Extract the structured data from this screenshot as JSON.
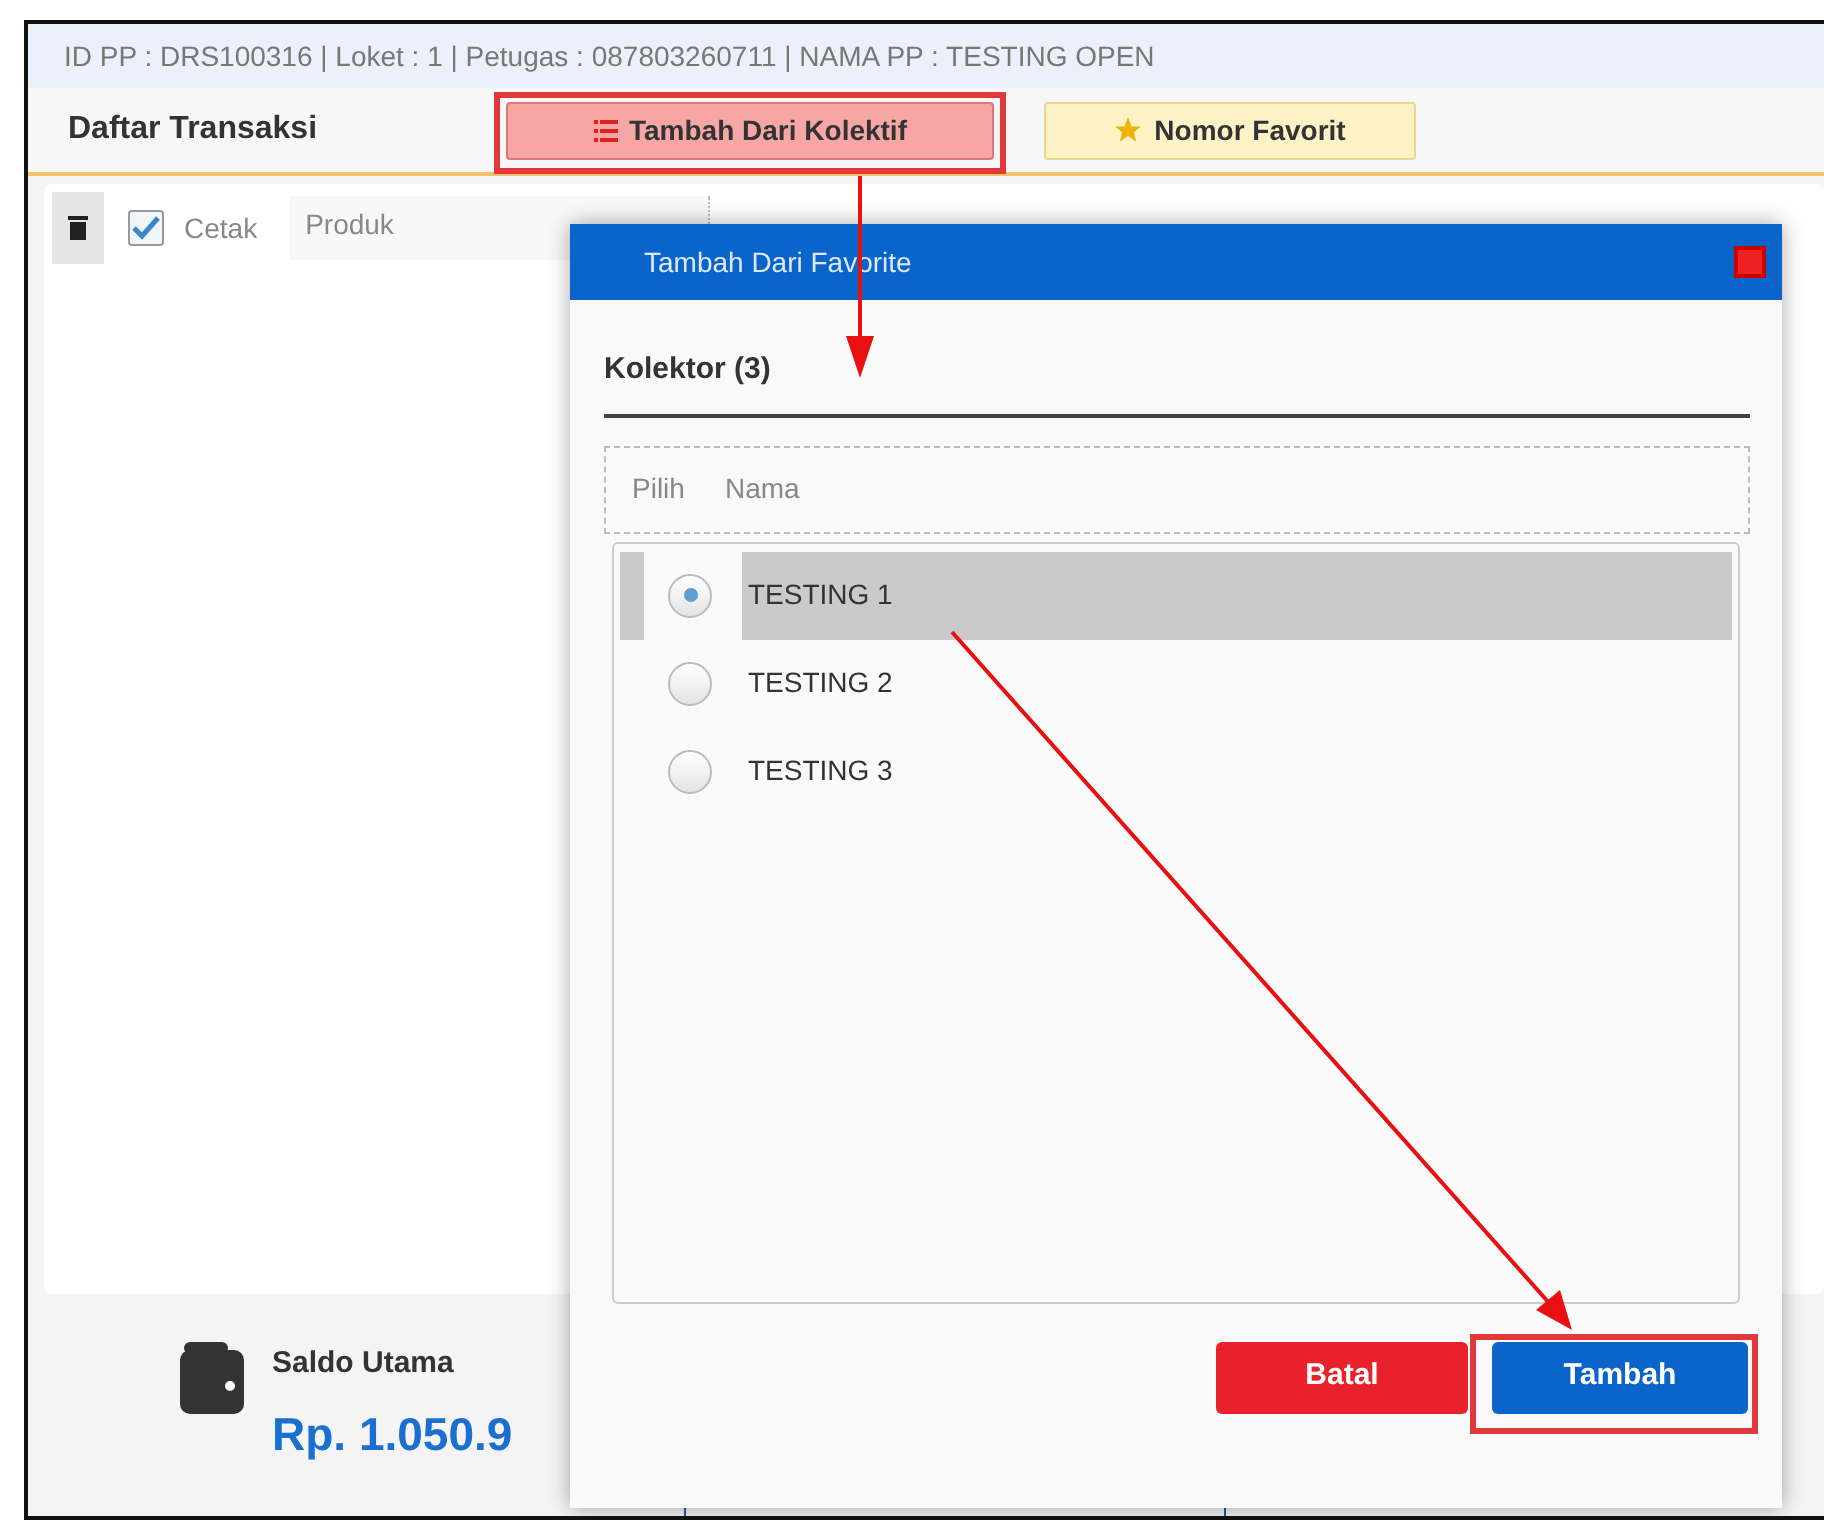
{
  "info_bar": "ID PP : DRS100316 | Loket : 1 | Petugas : 087803260711 | NAMA PP : TESTING OPEN",
  "header": {
    "title": "Daftar Transaksi",
    "buttons": [
      {
        "label": "Tambah Dari Kolektif",
        "kind": "kolektif"
      },
      {
        "label": "Nomor Favorit",
        "kind": "favorit"
      }
    ]
  },
  "toolbar": {
    "print": {
      "label": "Cetak",
      "checked": true
    },
    "columns": [
      "Produk"
    ]
  },
  "balance": {
    "label": "Saldo Utama",
    "amount": "Rp. 1.050.9"
  },
  "dialog": {
    "title": "Tambah Dari Favorite",
    "section": "Kolektor (3)",
    "columns": [
      "Pilih",
      "Nama"
    ],
    "rows": [
      {
        "name": "TESTING 1",
        "selected": true
      },
      {
        "name": "TESTING 2",
        "selected": false
      },
      {
        "name": "TESTING 3",
        "selected": false
      }
    ],
    "buttons": [
      {
        "label": "Batal",
        "kind": "cancel"
      },
      {
        "label": "Tambah",
        "kind": "confirm"
      }
    ]
  }
}
